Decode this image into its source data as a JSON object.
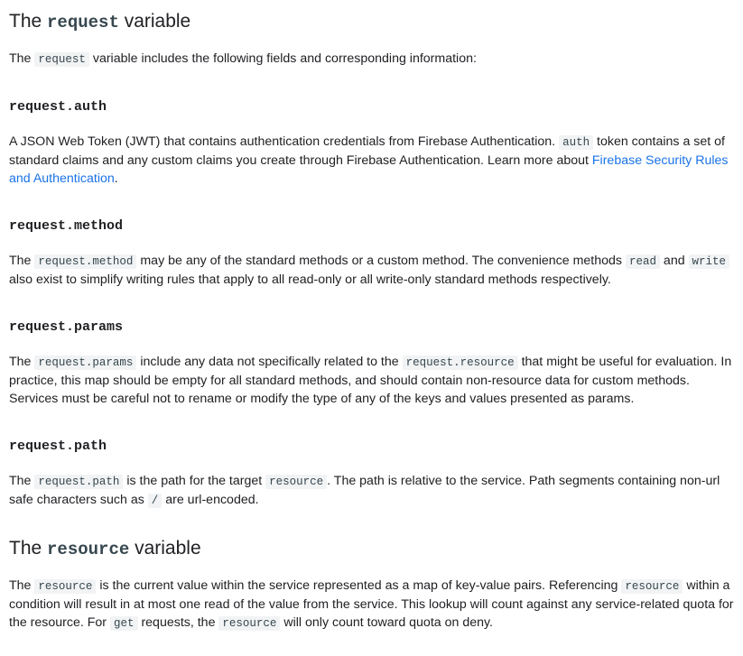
{
  "section_request": {
    "title_prefix": "The ",
    "title_code": "request",
    "title_suffix": " variable",
    "intro": {
      "a": "The ",
      "code": "request",
      "b": " variable includes the following fields and corresponding information:"
    }
  },
  "auth": {
    "heading": "request.auth",
    "a": "A JSON Web Token (JWT) that contains authentication credentials from Firebase Authentication. ",
    "code": "auth",
    "b": " token contains a set of standard claims and any custom claims you create through Firebase Authentication. Learn more about ",
    "link": "Firebase Security Rules and Authentication",
    "c": "."
  },
  "method": {
    "heading": "request.method",
    "a": "The ",
    "code1": "request.method",
    "b": " may be any of the standard methods or a custom method. The convenience methods ",
    "code2": "read",
    "c": " and ",
    "code3": "write",
    "d": " also exist to simplify writing rules that apply to all read-only or all write-only standard methods respectively."
  },
  "params": {
    "heading": "request.params",
    "a": "The ",
    "code1": "request.params",
    "b": " include any data not specifically related to the ",
    "code2": "request.resource",
    "c": " that might be useful for evaluation. In practice, this map should be empty for all standard methods, and should contain non-resource data for custom methods. Services must be careful not to rename or modify the type of any of the keys and values presented as params."
  },
  "path": {
    "heading": "request.path",
    "a": "The ",
    "code1": "request.path",
    "b": " is the path for the target ",
    "code2": "resource",
    "c": ". The path is relative to the service. Path segments containing non-url safe characters such as ",
    "code3": "/",
    "d": " are url-encoded."
  },
  "section_resource": {
    "title_prefix": "The ",
    "title_code": "resource",
    "title_suffix": " variable",
    "a": "The ",
    "code1": "resource",
    "b": " is the current value within the service represented as a map of key-value pairs. Referencing ",
    "code2": "resource",
    "c": " within a condition will result in at most one read of the value from the service. This lookup will count against any service-related quota for the resource. For ",
    "code3": "get",
    "d": " requests, the ",
    "code4": "resource",
    "e": " will only count toward quota on deny."
  }
}
